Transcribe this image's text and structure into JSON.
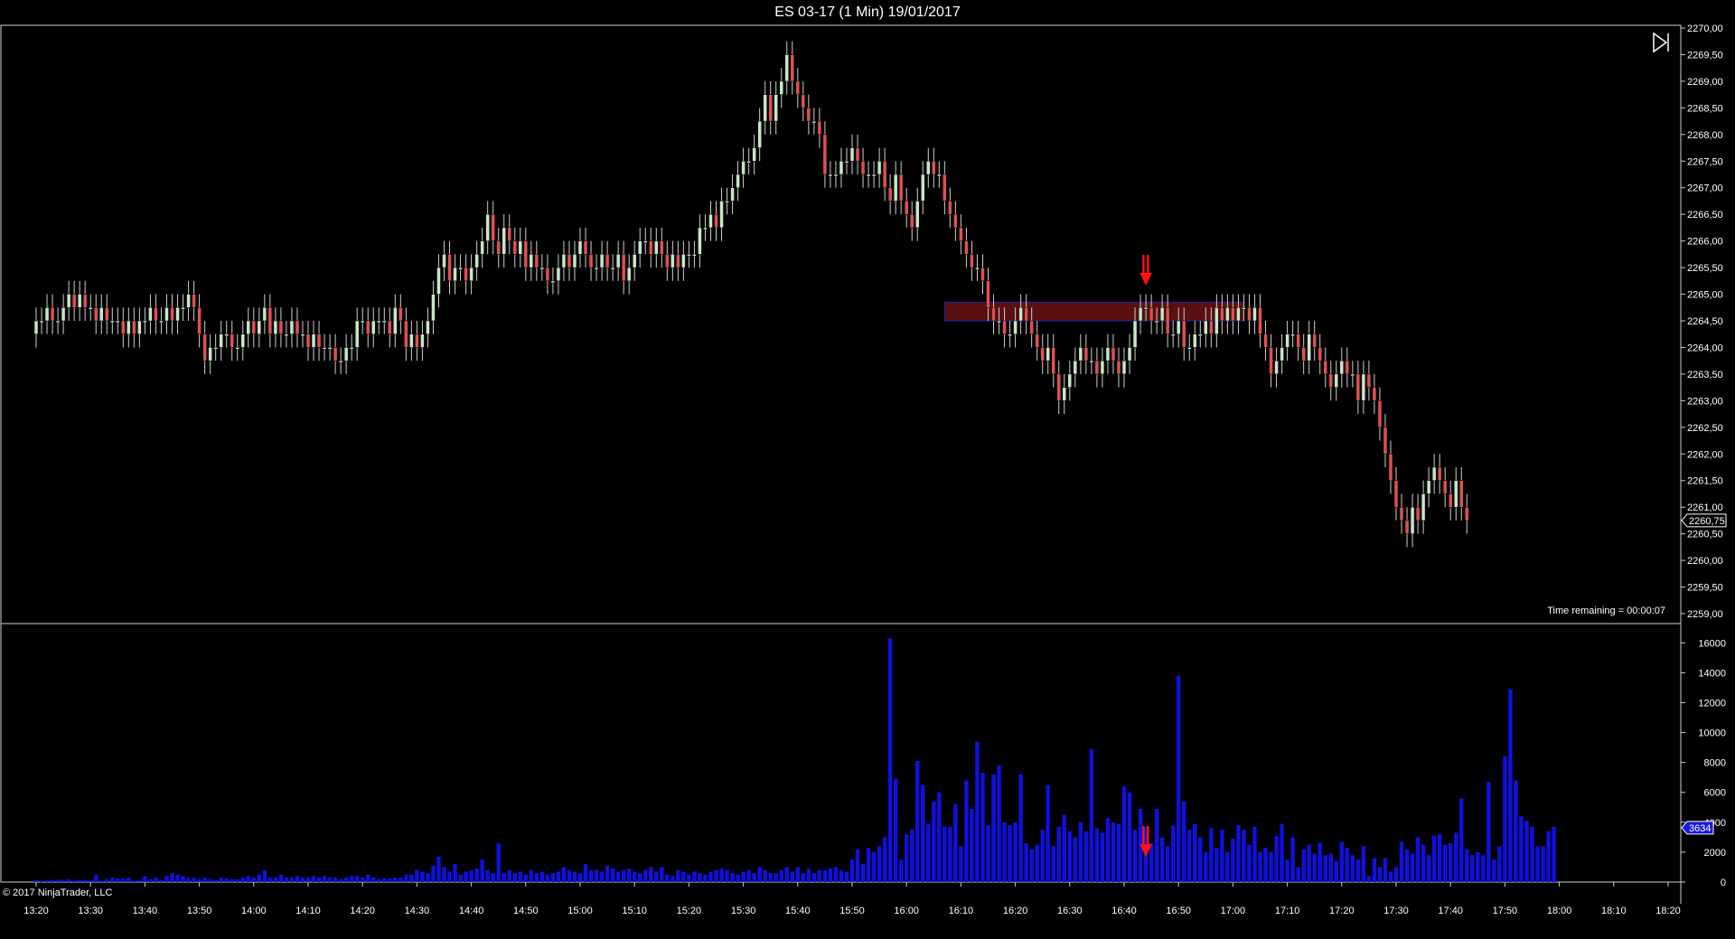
{
  "window": {
    "title": "ES 03-17 (1 Min)  19/01/2017"
  },
  "overlay": {
    "time_remaining": "Time remaining = 00:00:07",
    "copyright": "© 2017 NinjaTrader, LLC",
    "current_price_label": "2260,75",
    "current_volume_label": "3634",
    "autoscroll_icon": "skip-to-end-icon"
  },
  "colors": {
    "background": "#000000",
    "up_candle": "#c8e6c8",
    "down_candle": "#e05050",
    "volume": "#1010e0",
    "zone_fill": "#5a1010",
    "zone_border": "#2020c0",
    "arrow": "#ff1010"
  },
  "chart_data": [
    {
      "type": "candlestick",
      "title": "ES 03-17 (1 Min)  19/01/2017",
      "x_start": "13:20",
      "x_end": "18:20",
      "x_ticks": [
        "13:20",
        "13:30",
        "13:40",
        "13:50",
        "14:00",
        "14:10",
        "14:20",
        "14:30",
        "14:40",
        "14:50",
        "15:00",
        "15:10",
        "15:20",
        "15:30",
        "15:40",
        "15:50",
        "16:00",
        "16:10",
        "16:20",
        "16:30",
        "16:40",
        "16:50",
        "17:00",
        "17:10",
        "17:20",
        "17:30",
        "17:40",
        "17:50",
        "18:00",
        "18:10",
        "18:20"
      ],
      "y_ticks": [
        "2259,00",
        "2259,50",
        "2260,00",
        "2260,50",
        "2261,00",
        "2261,50",
        "2262,00",
        "2262,50",
        "2263,00",
        "2263,50",
        "2264,00",
        "2264,50",
        "2265,00",
        "2265,50",
        "2266,00",
        "2266,50",
        "2267,00",
        "2267,50",
        "2268,00",
        "2268,50",
        "2269,00",
        "2269,50",
        "2270,00"
      ],
      "ylim": [
        2259,
        2270
      ],
      "last_price": 2260.75,
      "zone": {
        "from": "16:07",
        "to": "17:02",
        "low": 2264.5,
        "high": 2264.85
      },
      "arrow_at": "16:44",
      "series": [
        {
          "start_time": "13:20",
          "interval_minutes": 1,
          "close": [
            2264.5,
            2264.5,
            2264.75,
            2264.5,
            2264.5,
            2264.75,
            2265,
            2264.75,
            2265,
            2264.75,
            2264.75,
            2264.5,
            2264.75,
            2264.5,
            2264.5,
            2264.5,
            2264.25,
            2264.5,
            2264.25,
            2264.5,
            2264.5,
            2264.75,
            2264.5,
            2264.5,
            2264.75,
            2264.5,
            2264.75,
            2264.75,
            2265,
            2264.75,
            2264.25,
            2263.75,
            2264,
            2264,
            2264.25,
            2264.25,
            2264,
            2264,
            2264.25,
            2264.5,
            2264.25,
            2264.5,
            2264.75,
            2264.25,
            2264.5,
            2264.25,
            2264.25,
            2264.5,
            2264.25,
            2264.25,
            2264,
            2264.25,
            2264,
            2264,
            2264,
            2263.75,
            2263.75,
            2264,
            2264,
            2264.5,
            2264.5,
            2264.25,
            2264.5,
            2264.5,
            2264.5,
            2264.25,
            2264.75,
            2264.5,
            2264,
            2264.25,
            2264,
            2264.25,
            2264.5,
            2265,
            2265.5,
            2265.75,
            2265.25,
            2265.5,
            2265.5,
            2265.25,
            2265.5,
            2265.75,
            2266,
            2266.5,
            2266,
            2265.75,
            2266.25,
            2266,
            2265.75,
            2266,
            2265.5,
            2265.75,
            2265.5,
            2265.5,
            2265.25,
            2265.25,
            2265.5,
            2265.75,
            2265.5,
            2265.75,
            2266,
            2265.75,
            2265.5,
            2265.5,
            2265.75,
            2265.5,
            2265.5,
            2265.75,
            2265.25,
            2265.5,
            2265.75,
            2266,
            2266,
            2265.75,
            2266,
            2265.75,
            2265.5,
            2265.75,
            2265.5,
            2265.75,
            2265.75,
            2265.75,
            2266.25,
            2266.25,
            2266.5,
            2266.25,
            2266.75,
            2266.75,
            2267,
            2267.25,
            2267.5,
            2267.5,
            2267.75,
            2268.25,
            2268.75,
            2268.25,
            2268.75,
            2269,
            2269.5,
            2269,
            2268.75,
            2268.5,
            2268.25,
            2268.25,
            2268,
            2267.25,
            2267.25,
            2267.25,
            2267.5,
            2267.5,
            2267.75,
            2267.5,
            2267.25,
            2267.25,
            2267.25,
            2267.5,
            2267,
            2266.75,
            2267.25,
            2266.75,
            2266.5,
            2266.25,
            2266.75,
            2267.25,
            2267.5,
            2267.25,
            2267.25,
            2266.75,
            2266.5,
            2266.25,
            2266,
            2265.75,
            2265.5,
            2265.5,
            2265.25,
            2264.75,
            2264.5,
            2264.5,
            2264.25,
            2264.25,
            2264.5,
            2264.75,
            2264.5,
            2264.25,
            2264,
            2263.75,
            2264,
            2263.5,
            2263,
            2263.25,
            2263.5,
            2263.75,
            2264,
            2263.75,
            2263.75,
            2263.5,
            2263.75,
            2264,
            2263.75,
            2263.5,
            2263.75,
            2264,
            2264.5,
            2264.75,
            2264.75,
            2264.5,
            2264.5,
            2264.75,
            2264.25,
            2264.25,
            2264.5,
            2264,
            2264,
            2264.25,
            2264.25,
            2264.5,
            2264.25,
            2264.75,
            2264.5,
            2264.75,
            2264.5,
            2264.75,
            2264.75,
            2264.5,
            2264.75,
            2264.25,
            2264,
            2263.5,
            2263.75,
            2264,
            2264.25,
            2264.25,
            2264,
            2263.75,
            2264.25,
            2264,
            2263.75,
            2263.5,
            2263.25,
            2263.5,
            2263.75,
            2263.5,
            2263.5,
            2263,
            2263.5,
            2263.25,
            2263,
            2262.5,
            2262,
            2261.5,
            2261,
            2260.75,
            2260.5,
            2261,
            2260.75,
            2261.25,
            2261.5,
            2261.75,
            2261.5,
            2261.25,
            2261,
            2261.5,
            2261,
            2260.75
          ]
        }
      ]
    },
    {
      "type": "bar",
      "title": "",
      "x_start": "13:20",
      "interval_minutes": 1,
      "y_ticks": [
        "0",
        "2000",
        "4000",
        "6000",
        "8000",
        "10000",
        "12000",
        "14000",
        "16000"
      ],
      "ylim": [
        0,
        16500
      ],
      "last_value": 3634,
      "arrow_at": "16:44",
      "series": [
        {
          "values": [
            150,
            100,
            120,
            130,
            160,
            150,
            200,
            100,
            140,
            150,
            130,
            500,
            100,
            200,
            300,
            250,
            250,
            300,
            100,
            150,
            400,
            200,
            300,
            150,
            400,
            600,
            500,
            400,
            300,
            300,
            200,
            300,
            200,
            150,
            300,
            250,
            200,
            200,
            300,
            400,
            300,
            500,
            800,
            300,
            300,
            500,
            300,
            300,
            400,
            300,
            300,
            400,
            300,
            400,
            300,
            300,
            200,
            300,
            400,
            400,
            300,
            500,
            300,
            200,
            250,
            250,
            300,
            300,
            500,
            500,
            800,
            700,
            600,
            1100,
            1700,
            1000,
            700,
            1200,
            500,
            700,
            800,
            900,
            1500,
            800,
            600,
            2600,
            600,
            800,
            600,
            700,
            500,
            800,
            600,
            700,
            500,
            600,
            700,
            1000,
            800,
            700,
            600,
            1200,
            800,
            800,
            700,
            1100,
            900,
            700,
            800,
            900,
            700,
            600,
            800,
            1000,
            700,
            1000,
            500,
            400,
            800,
            700,
            500,
            700,
            600,
            500,
            700,
            800,
            900,
            800,
            600,
            500,
            700,
            800,
            600,
            1000,
            800,
            600,
            600,
            800,
            1000,
            700,
            1000,
            600,
            900,
            600,
            800,
            800,
            900,
            1000,
            800,
            700,
            1500,
            2200,
            1200,
            2300,
            2000,
            2400,
            3000,
            16300,
            6900,
            1500,
            3200,
            3500,
            8100,
            6500,
            3900,
            5400,
            6000,
            3700,
            3700,
            5200,
            2400,
            6800,
            4900,
            9400,
            7300,
            3800,
            7200,
            7800,
            4000,
            3800,
            4000,
            7200,
            2600,
            2200,
            2500,
            3500,
            6500,
            2400,
            3700,
            4500,
            3400,
            3000,
            4000,
            3400,
            8900,
            3600,
            3300,
            4300,
            4000,
            3900,
            6400,
            6000,
            3500,
            4900,
            3700,
            2600,
            4900,
            3000,
            2400,
            3800,
            13800,
            5400,
            3500,
            3900,
            3000,
            2000,
            3600,
            2300,
            3500,
            2000,
            2900,
            3800,
            3500,
            2500,
            3700,
            2000,
            2300,
            2000,
            3100,
            3900,
            1500,
            3000,
            1000,
            2200,
            2500,
            1900,
            2600,
            1800,
            1900,
            1400,
            2700,
            2300,
            1800,
            1500,
            2400,
            400,
            1600,
            1000,
            1600,
            700,
            1000,
            2700,
            2200,
            1900,
            3000,
            2500,
            1800,
            3100,
            3200,
            2500,
            2600,
            3300,
            5600,
            2200,
            1800,
            2000,
            1800,
            6700,
            1500,
            2400,
            8400,
            12900,
            6800,
            4400,
            4100,
            3700,
            2400,
            2400,
            3400,
            3700
          ]
        }
      ]
    }
  ]
}
